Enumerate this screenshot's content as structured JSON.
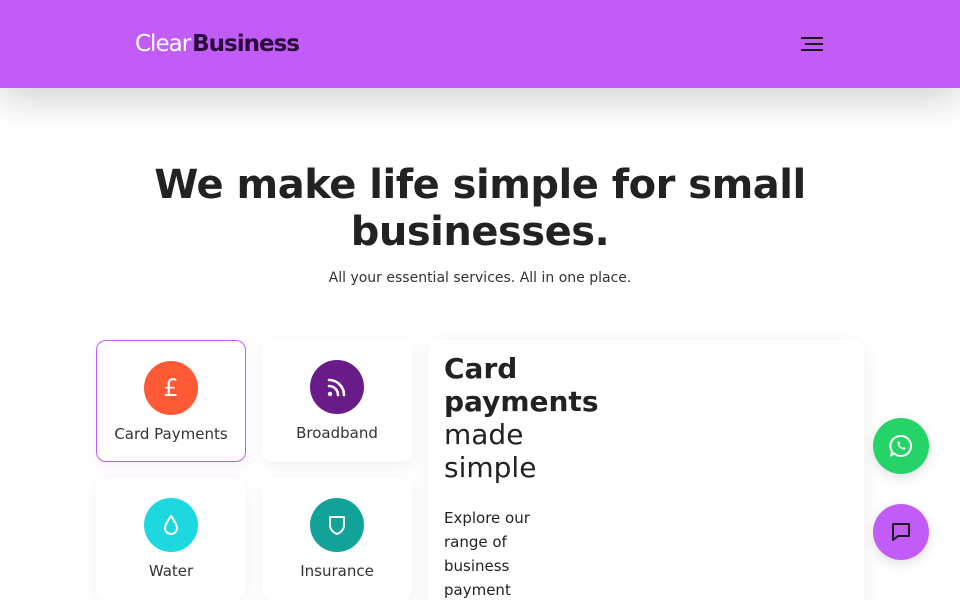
{
  "header": {
    "logo_clear": "Clear",
    "logo_business": "Business",
    "menu_icon": "hamburger-menu-icon"
  },
  "hero": {
    "headline_pre": "We make life ",
    "headline_bold": "simple",
    "headline_post": " for small businesses.",
    "subline": "All your essential services. All in one place."
  },
  "services": [
    {
      "label": "Card Payments",
      "icon": "pound-sign-icon",
      "color": "#ff5a36",
      "active": true
    },
    {
      "label": "Broadband",
      "icon": "wifi-icon",
      "color": "#6a1b8a",
      "active": false
    },
    {
      "label": "Water",
      "icon": "water-drop-icon",
      "color": "#1ed8e0",
      "active": false
    },
    {
      "label": "Insurance",
      "icon": "shield-icon",
      "color": "#11a39a",
      "active": false
    }
  ],
  "detail": {
    "title_line1": "Card",
    "title_line2": "payments",
    "title_line3": "made",
    "title_line4": "simple",
    "description": "Explore our range of business payment"
  },
  "fabs": {
    "whatsapp_icon": "whatsapp-icon",
    "chat_icon": "chat-icon"
  },
  "colors": {
    "brand_purple": "#c25cf7",
    "logo_dark": "#2b0b3e",
    "whatsapp_green": "#25d366"
  }
}
